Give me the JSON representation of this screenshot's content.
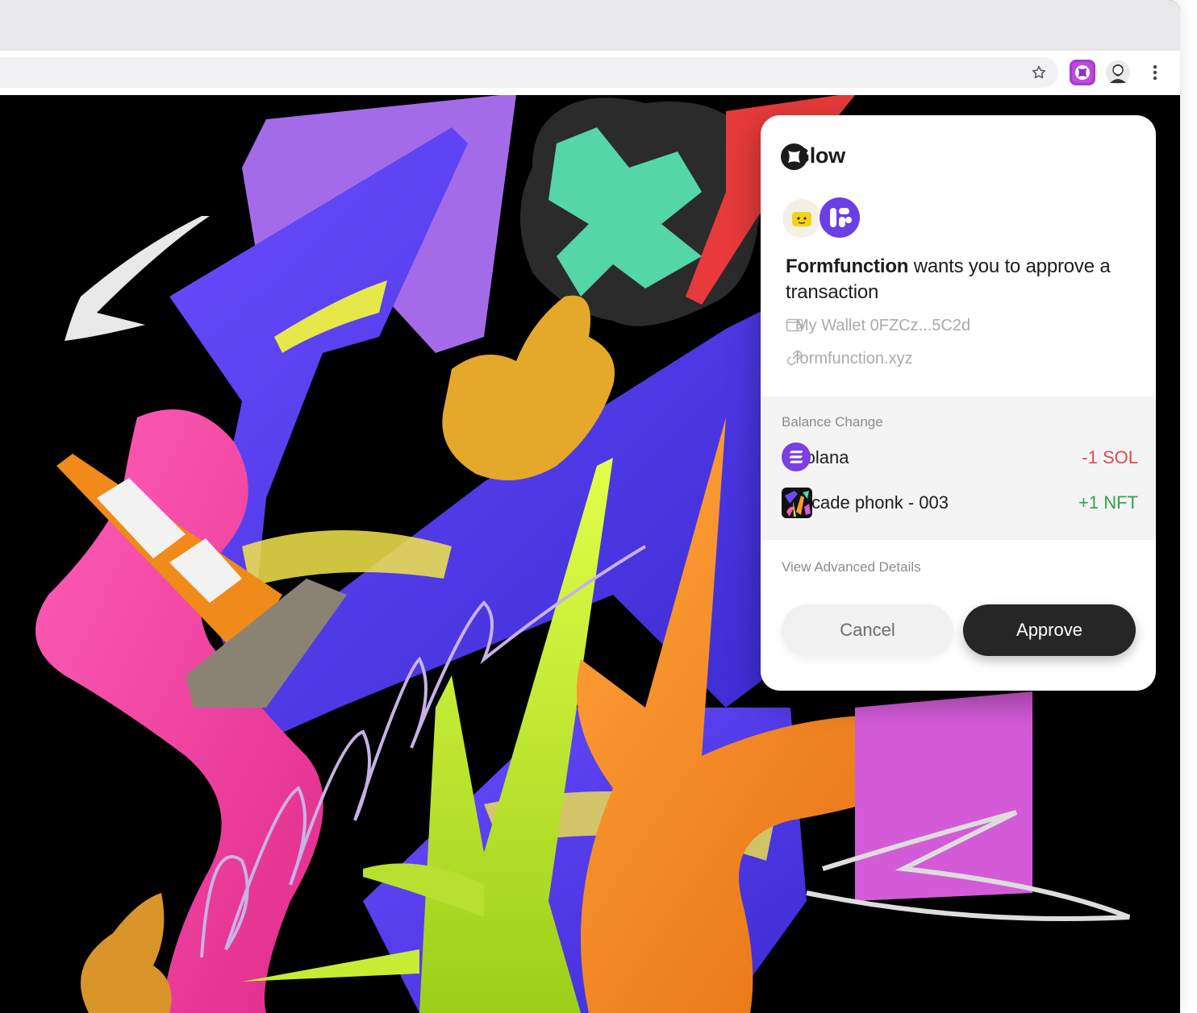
{
  "browser": {
    "toolbar": {
      "bookmark_icon": "star-outline-icon",
      "extension_icon": "glow-extension-icon",
      "profile_icon": "profile-avatar",
      "menu_icon": "kebab-menu-icon"
    }
  },
  "popup": {
    "brand": {
      "name": "Glow",
      "logo_icon": "glow-logo-icon"
    },
    "request": {
      "app_name": "Formfunction",
      "message": " wants you to approve a transaction"
    },
    "wallet": {
      "icon": "wallet-icon",
      "label": "My Wallet 0FZCz...5C2d"
    },
    "site": {
      "icon": "link-icon",
      "label": "formfunction.xyz"
    },
    "balance_change": {
      "title": "Balance Change",
      "items": [
        {
          "name": "Solana",
          "value": "-1 SOL",
          "icon": "solana-icon",
          "color": "#e5484d"
        },
        {
          "name": "Arcade phonk - 003",
          "value": "+1 NFT",
          "icon": "nft-thumbnail",
          "color": "#2ea44f"
        }
      ]
    },
    "advanced_link": "View Advanced Details",
    "buttons": {
      "cancel": "Cancel",
      "approve": "Approve"
    }
  },
  "colors": {
    "accent_purple": "#7b3fe4",
    "approve_bg": "#262626",
    "negative": "#e5484d",
    "positive": "#2ea44f"
  }
}
